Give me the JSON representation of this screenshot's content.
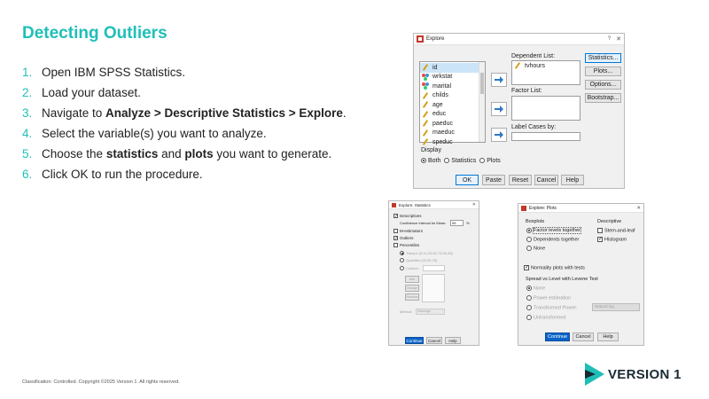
{
  "slide": {
    "title": "Detecting Outliers",
    "steps": [
      {
        "num": "1.",
        "pre": "Open IBM SPSS Statistics.",
        "b1": "",
        "mid": "",
        "b2": "",
        "post": ""
      },
      {
        "num": "2.",
        "pre": "Load your dataset.",
        "b1": "",
        "mid": "",
        "b2": "",
        "post": ""
      },
      {
        "num": "3.",
        "pre": "Navigate to ",
        "b1": "Analyze > Descriptive Statistics > Explore",
        "mid": ".",
        "b2": "",
        "post": ""
      },
      {
        "num": "4.",
        "pre": "Select the variable(s) you want to analyze.",
        "b1": "",
        "mid": "",
        "b2": "",
        "post": ""
      },
      {
        "num": "5.",
        "pre": "Choose the ",
        "b1": "statistics",
        "mid": " and ",
        "b2": "plots",
        "post": " you want to generate."
      },
      {
        "num": "6.",
        "pre": "Click OK to run the procedure.",
        "b1": "",
        "mid": "",
        "b2": "",
        "post": ""
      }
    ],
    "footer": "Classification: Controlled. Copyright ©2025 Version 1. All rights reserved.",
    "logo_text": "VERSION 1"
  },
  "colors": {
    "accent": "#1fbfb8",
    "primary_button": "#0a64c8",
    "logo_dark": "#1a2a33"
  },
  "explore": {
    "title": "Explore",
    "help_glyph": "?",
    "close_glyph": "✕",
    "variables": [
      "id",
      "wrkstat",
      "marital",
      "childs",
      "age",
      "educ",
      "paeduc",
      "maeduc",
      "speduc"
    ],
    "dependent_label": "Dependent List:",
    "dependent_items": [
      "tvhours"
    ],
    "factor_label": "Factor List:",
    "label_cases": "Label Cases by:",
    "display_label": "Display",
    "display_options": [
      "Both",
      "Statistics",
      "Plots"
    ],
    "side_buttons": [
      "Statistics...",
      "Plots...",
      "Options...",
      "Bootstrap..."
    ],
    "bottom_buttons": [
      "OK",
      "Paste",
      "Reset",
      "Cancel",
      "Help"
    ]
  },
  "stats": {
    "title": "Explore: Statistics",
    "descriptives": "Descriptives",
    "ci_label": "Confidence Interval for Mean:",
    "ci_value": "95",
    "ci_unit": "%",
    "m_estimators": "M-estimators",
    "outliers": "Outliers",
    "percentiles": "Percentiles",
    "pct_opt1": "Tukey's (5,10,25,50,75,90,95)",
    "pct_opt2": "Quartiles (25,50,75)",
    "custom": "Custom:",
    "list_buttons": [
      "Add",
      "Change",
      "Remove"
    ],
    "method_label": "Method:",
    "method_value": "Haverage",
    "bottom_buttons": [
      "Continue",
      "Cancel",
      "Help"
    ]
  },
  "plots": {
    "title": "Explore: Plots",
    "boxplots": "Boxplots",
    "box_options": [
      "Factor levels together",
      "Dependents together",
      "None"
    ],
    "descriptive": "Descriptive",
    "desc_options": [
      "Stem-and-leaf",
      "Histogram"
    ],
    "normality": "Normality plots with tests",
    "spread_label": "Spread vs Level with Levene Test",
    "spread_options": [
      "None",
      "Power estimation",
      "Transformed",
      "Untransformed"
    ],
    "power_label": "Power:",
    "power_value": "Natural log",
    "bottom_buttons": [
      "Continue",
      "Cancel",
      "Help"
    ]
  }
}
